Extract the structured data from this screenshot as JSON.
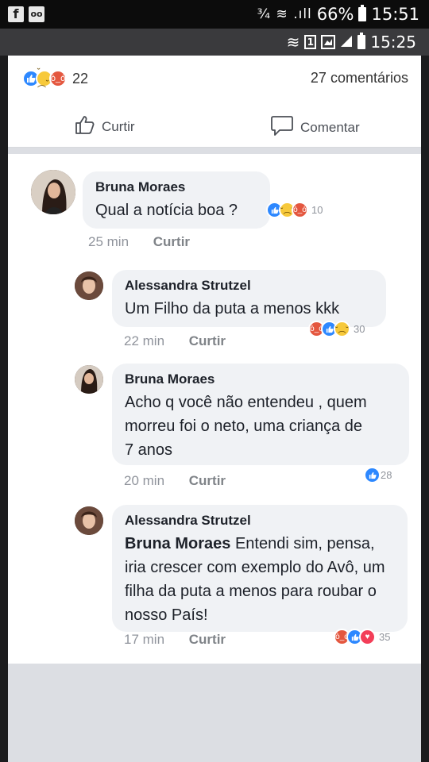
{
  "outer_status": {
    "app_icons": [
      "f",
      "oo"
    ],
    "indicators": "¾ ≋ .ıll",
    "battery": "66%",
    "time": "15:51"
  },
  "inner_status": {
    "indicators": "≋",
    "box_label": "1",
    "time": "15:25"
  },
  "post": {
    "reaction_count": "22",
    "comments_label": "27 comentários",
    "like_label": "Curtir",
    "comment_label": "Comentar"
  },
  "comments": [
    {
      "name": "Bruna Moraes",
      "text": "Qual a notícia boa ?",
      "time": "25 min",
      "like": "Curtir",
      "reactions": "10"
    },
    {
      "name": "Alessandra Strutzel",
      "text": "Um Filho da puta a menos kkk",
      "time": "22 min",
      "like": "Curtir",
      "reactions": "30"
    },
    {
      "name": "Bruna Moraes",
      "text": "Acho q você não entendeu , quem morreu foi o neto, uma criança de 7 anos",
      "time": "20 min",
      "like": "Curtir",
      "reactions": "28"
    },
    {
      "name": "Alessandra Strutzel",
      "mention": "Bruna Moraes",
      "text": "Entendi sim, pensa, iria crescer com exemplo do Avô, um filha da puta a menos para roubar o nosso País!",
      "time": "17 min",
      "like": "Curtir",
      "reactions": "35"
    }
  ],
  "colors": {
    "like_blue": "#2d88ff",
    "sad_yellow": "#f7c93b",
    "angry_red": "#e4573f",
    "love_red": "#f33e58",
    "bubble": "#f0f2f5"
  }
}
